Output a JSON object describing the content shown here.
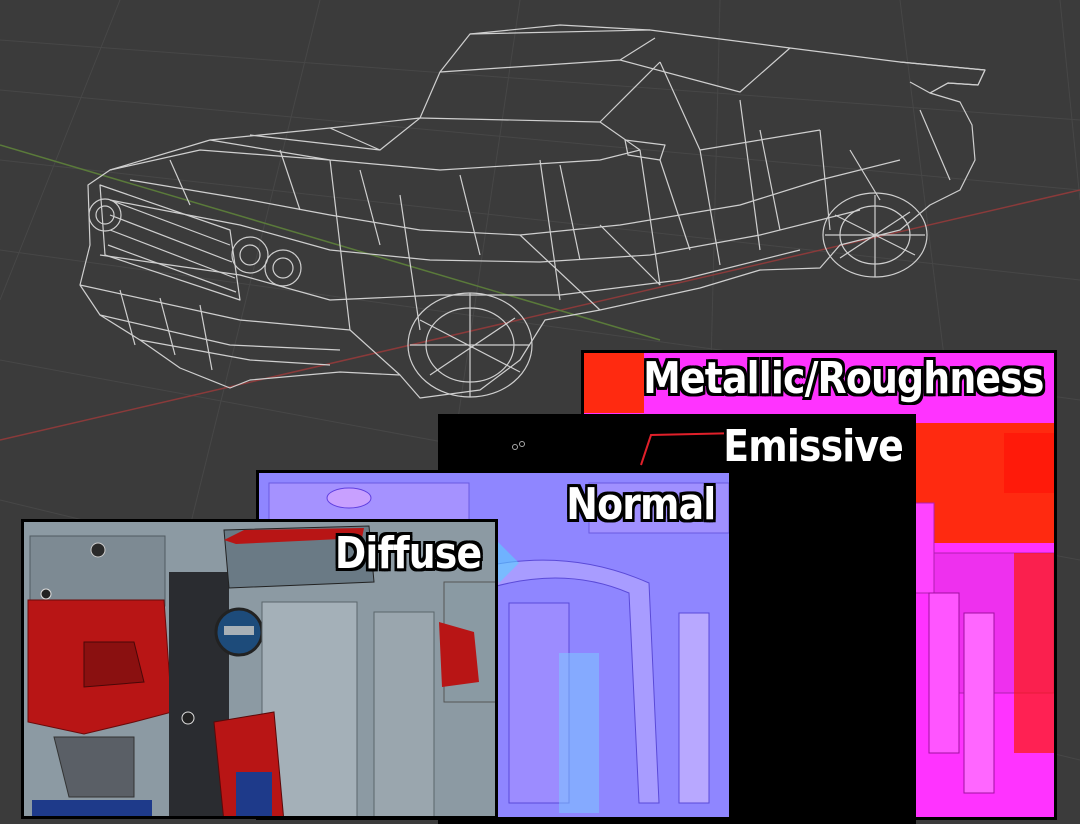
{
  "viewport": {
    "background": "#3b3b3b",
    "grid_color": "#474747",
    "x_axis_color": "#8a3a3a",
    "y_axis_color": "#5a7a3a",
    "wireframe_color": "#cfcfcf",
    "model": "car-wireframe"
  },
  "panels": [
    {
      "id": "metallic_roughness",
      "label": "Metallic/Roughness",
      "base_color": "#ff33ff",
      "accent": "#ff2a10"
    },
    {
      "id": "emissive",
      "label": "Emissive",
      "base_color": "#000000",
      "accent": "#e0202a"
    },
    {
      "id": "normal",
      "label": "Normal",
      "base_color": "#8f86ff",
      "accent": "#5ad0ff"
    },
    {
      "id": "diffuse",
      "label": "Diffuse",
      "base_color": "#8c9aa3",
      "accent": "#b81515"
    }
  ]
}
